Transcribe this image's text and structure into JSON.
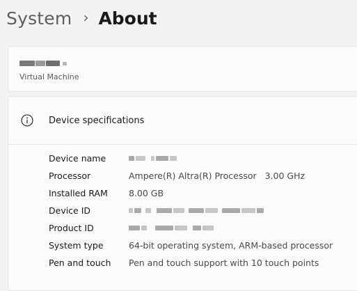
{
  "breadcrumb": {
    "parent": "System",
    "separator": "›",
    "current": "About"
  },
  "device": {
    "kind": "Virtual Machine"
  },
  "specs": {
    "title": "Device specifications",
    "rows": [
      {
        "label": "Device name",
        "value": ""
      },
      {
        "label": "Processor",
        "value": "Ampere(R) Altra(R) Processor   3.00 GHz"
      },
      {
        "label": "Installed RAM",
        "value": "8.00 GB"
      },
      {
        "label": "Device ID",
        "value": ""
      },
      {
        "label": "Product ID",
        "value": ""
      },
      {
        "label": "System type",
        "value": "64-bit operating system, ARM-based processor"
      },
      {
        "label": "Pen and touch",
        "value": "Pen and touch support with 10 touch points"
      }
    ]
  },
  "icons": {
    "info": "info-circle-icon"
  }
}
